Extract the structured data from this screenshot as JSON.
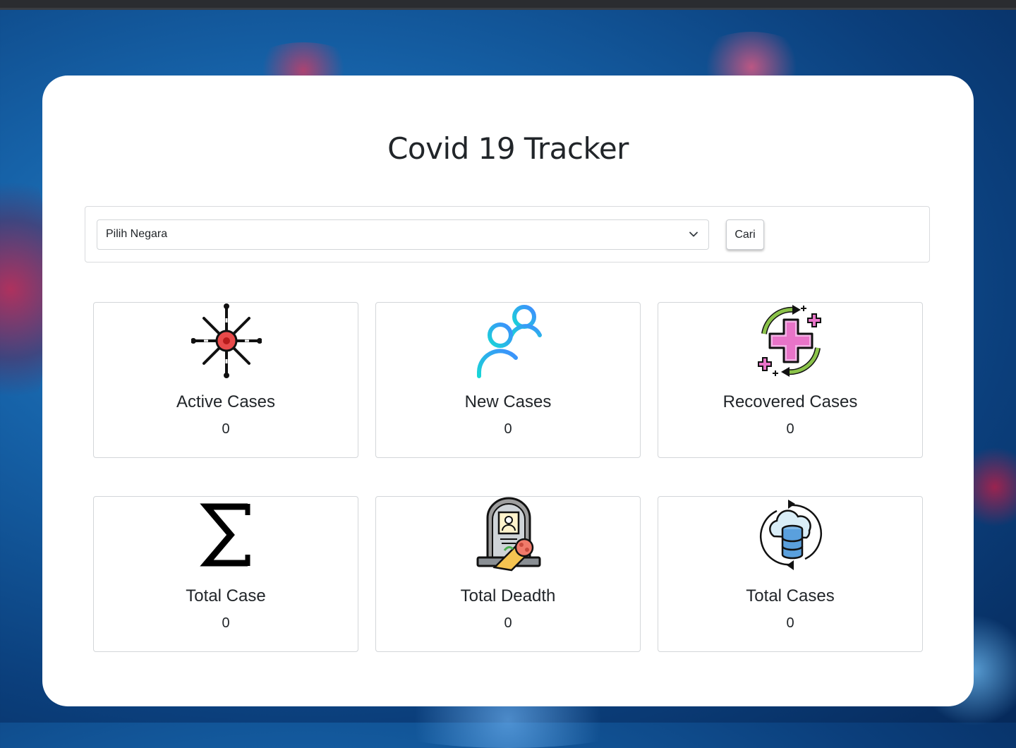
{
  "header": {
    "title": "Covid 19 Tracker"
  },
  "search": {
    "select_value": "Pilih Negara",
    "button_label": "Cari"
  },
  "stats": [
    {
      "label": "Active Cases",
      "value": "0",
      "icon": "virus-icon"
    },
    {
      "label": "New Cases",
      "value": "0",
      "icon": "add-users-icon"
    },
    {
      "label": "Recovered Cases",
      "value": "0",
      "icon": "medical-cross-recover-icon"
    },
    {
      "label": "Total Case",
      "value": "0",
      "icon": "sigma-icon"
    },
    {
      "label": "Total Deadth",
      "value": "0",
      "icon": "tombstone-icon"
    },
    {
      "label": "Total Cases",
      "value": "0",
      "icon": "cloud-database-icon"
    }
  ],
  "colors": {
    "background": "#1662a8",
    "card": "#ffffff",
    "text": "#212529",
    "border": "#d3d6d9",
    "virus_red": "#e84a4a",
    "users_blue": "#29b6f6",
    "cross_pink": "#e874c8",
    "arrow_green": "#8bc34a"
  }
}
